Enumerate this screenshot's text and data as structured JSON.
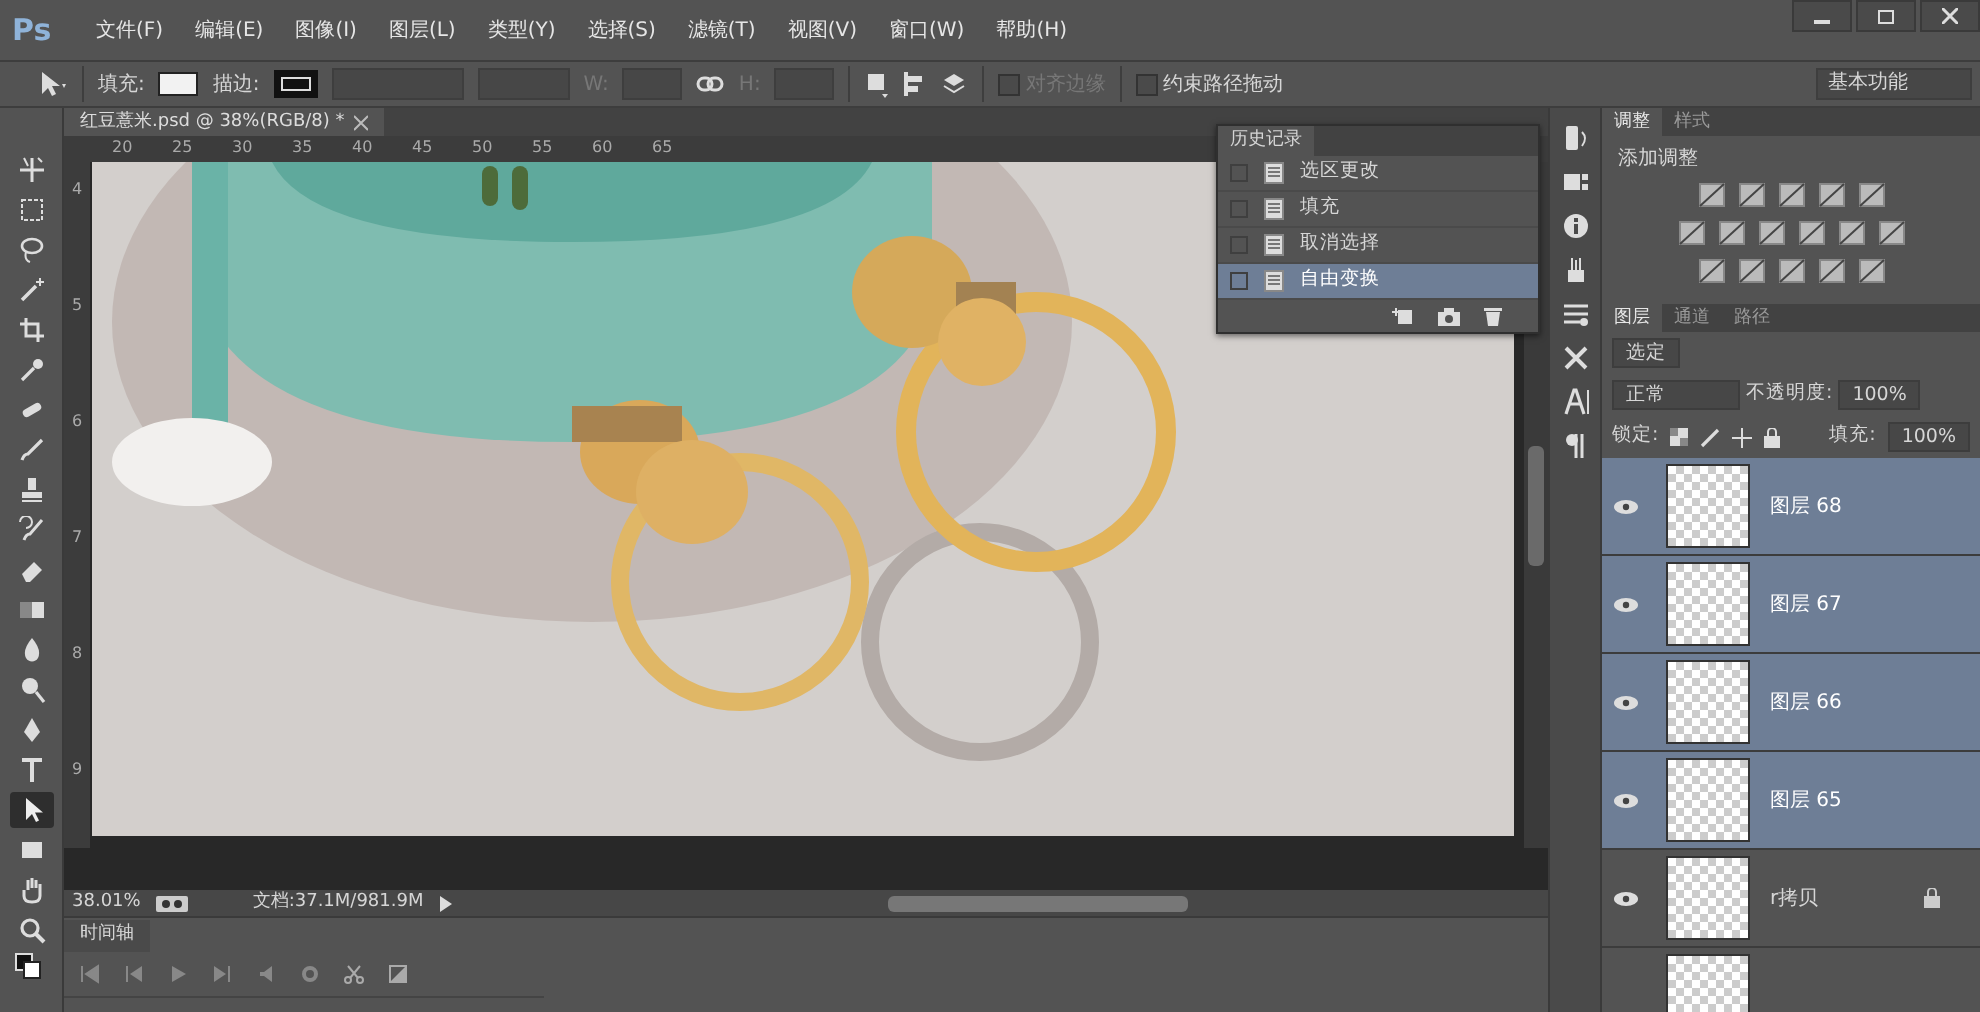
{
  "menu_bar": {
    "logo": "Ps",
    "items": [
      "文件(F)",
      "编辑(E)",
      "图像(I)",
      "图层(L)",
      "类型(Y)",
      "选择(S)",
      "滤镜(T)",
      "视图(V)",
      "窗口(W)",
      "帮助(H)"
    ]
  },
  "options_bar": {
    "fill_label": "填充:",
    "stroke_label": "描边:",
    "w_label": "W:",
    "h_label": "H:",
    "checkboxes": [
      {
        "label": "对齐边缘",
        "checked": false,
        "disabled": true
      },
      {
        "label": "约束路径拖动",
        "checked": false,
        "disabled": false
      }
    ],
    "workspace": "基本功能"
  },
  "toolbar": {
    "tools": [
      {
        "kind": "move",
        "selected": false
      },
      {
        "kind": "marquee",
        "selected": false
      },
      {
        "kind": "lasso",
        "selected": false
      },
      {
        "kind": "wand",
        "selected": false
      },
      {
        "kind": "crop",
        "selected": false
      },
      {
        "kind": "eyedropper",
        "selected": false
      },
      {
        "kind": "healing",
        "selected": false
      },
      {
        "kind": "brush",
        "selected": false
      },
      {
        "kind": "stamp",
        "selected": false
      },
      {
        "kind": "history",
        "selected": false
      },
      {
        "kind": "eraser",
        "selected": false
      },
      {
        "kind": "gradient",
        "selected": false
      },
      {
        "kind": "blur",
        "selected": false
      },
      {
        "kind": "dodge",
        "selected": false
      },
      {
        "kind": "pen",
        "selected": false
      },
      {
        "kind": "type",
        "selected": false
      },
      {
        "kind": "select",
        "selected": true
      },
      {
        "kind": "shape",
        "selected": false
      },
      {
        "kind": "hand",
        "selected": false
      },
      {
        "kind": "zoom",
        "selected": false
      }
    ]
  },
  "document": {
    "tab_title": "红豆薏米.psd @ 38%(RGB/8) *",
    "ruler_labels": [
      "20",
      "25",
      "30",
      "35",
      "40",
      "45",
      "50",
      "55",
      "60",
      "65"
    ],
    "ruler_side_labels": [
      "4",
      "5",
      "6",
      "7",
      "8",
      "9"
    ],
    "zoom": "38.01%",
    "doc_size": "文档:37.1M/981.9M"
  },
  "history_panel": {
    "title": "历史记录",
    "items": [
      {
        "label": "选区更改",
        "selected": false
      },
      {
        "label": "填充",
        "selected": false
      },
      {
        "label": "取消选择",
        "selected": false
      },
      {
        "label": "自由变换",
        "selected": true
      }
    ]
  },
  "timeline": {
    "title": "时间轴"
  },
  "adjustments_panel": {
    "tabs": [
      {
        "label": "调整",
        "selected": true
      },
      {
        "label": "样式",
        "selected": false
      }
    ],
    "heading": "添加调整"
  },
  "layers_panel": {
    "tabs": [
      {
        "label": "图层",
        "selected": true
      },
      {
        "label": "通道",
        "selected": false
      },
      {
        "label": "路径",
        "selected": false
      }
    ],
    "filter": "选定",
    "blend_mode": "正常",
    "opacity_label": "不透明度:",
    "opacity": "100%",
    "lock_label": "锁定:",
    "fill_label": "填充:",
    "fill": "100%",
    "layers": [
      {
        "name": "图层 68",
        "selected": true,
        "visible": true,
        "locked": false
      },
      {
        "name": "图层 67",
        "selected": true,
        "visible": true,
        "locked": false
      },
      {
        "name": "图层 66",
        "selected": true,
        "visible": true,
        "locked": false
      },
      {
        "name": "图层 65",
        "selected": true,
        "visible": true,
        "locked": false
      },
      {
        "name": "r拷贝",
        "selected": false,
        "visible": true,
        "locked": true
      }
    ]
  }
}
